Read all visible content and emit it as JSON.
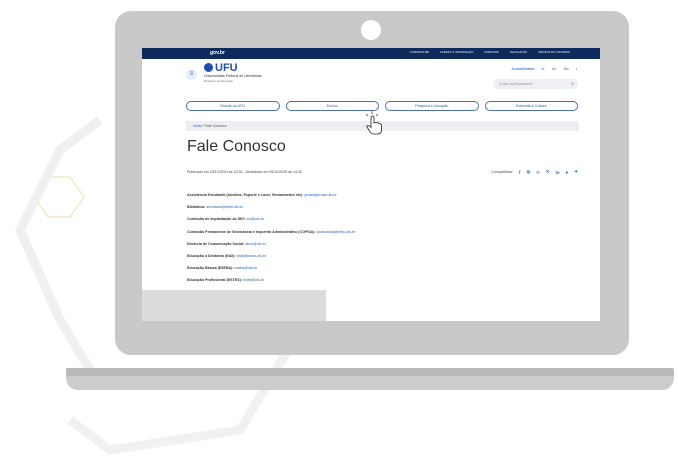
{
  "gov_bar": {
    "logo": "gov.br",
    "links": [
      "COMUNICA BR",
      "ACESSO À INFORMAÇÃO",
      "PARTICIPE",
      "LEGISLAÇÃO",
      "ÓRGÃOS DO GOVERNO"
    ]
  },
  "header": {
    "brand": "UFU",
    "brand_sub": "Universidade Federal de Uberlândia",
    "brand_sub2": "Ministério da Educação",
    "accessibility": "Acessibilidade",
    "font_smaller": "A-",
    "font_larger": "A+",
    "contrast": "A/c",
    "search_placeholder": "O que você procura?"
  },
  "nav": {
    "items": [
      "Estude na UFU",
      "Ensino",
      "Pesquisa e Inovação",
      "Extensão e Cultura"
    ]
  },
  "breadcrumb": {
    "home": "Início",
    "separator": "/",
    "current": "Fale Conosco"
  },
  "page": {
    "title": "Fale Conosco",
    "meta": "Publicado em 03/12/2024 às 15:35 - Atualizado em 05/12/2025 às 14:42",
    "share_label": "Compartilhar:"
  },
  "contacts": [
    {
      "label": "Assistência Estudantil (Auxílios, Esporte e Lazer, Restaurantes etc):",
      "email": "proae@proae.ufu.br"
    },
    {
      "label": "Biblioteca:",
      "email": "secretaria@dirbi.ufu.br"
    },
    {
      "label": "Comissão de Implantação do SEI!:",
      "email": "sei@ufu.br"
    },
    {
      "label": "Comissão Permanente de Sindicância e Inquérito Administrativo (COPSIA):",
      "email": "sindicancia@reito.ufu.br"
    },
    {
      "label": "Diretoria de Comunicação Social:",
      "email": "dirco@ufu.br"
    },
    {
      "label": "Educação a Distância (EaD):",
      "email": "cead@cead.ufu.br"
    },
    {
      "label": "Educação Básica (ESEBA):",
      "email": "eseba@ufu.br"
    },
    {
      "label": "Educação Profissional (ESTES):",
      "email": "estes@ufu.br"
    }
  ],
  "colors": {
    "gov_bar": "#0d2a5c",
    "accent": "#1f5fb8",
    "laptop": "#c9c9c9"
  }
}
